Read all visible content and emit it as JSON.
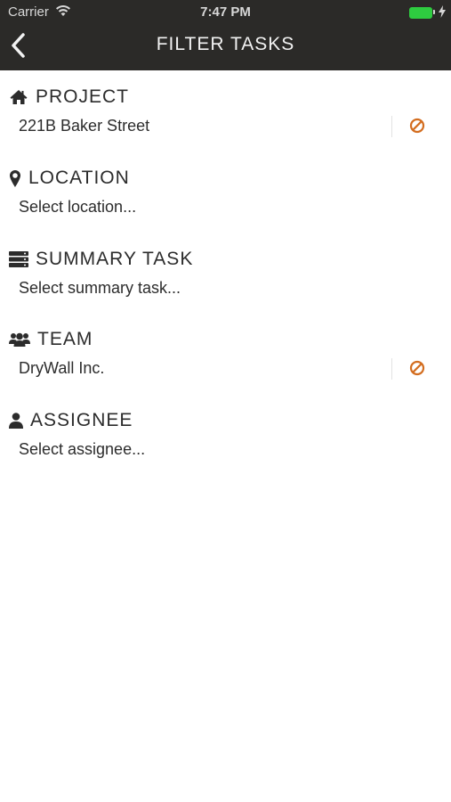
{
  "status_bar": {
    "carrier": "Carrier",
    "time": "7:47 PM"
  },
  "nav": {
    "title": "FILTER TASKS",
    "back_icon": "chevron-left-icon"
  },
  "colors": {
    "bar": "#2b2a28",
    "accent": "#d36d1f",
    "text": "#2c2c2c"
  },
  "sections": [
    {
      "title": "PROJECT",
      "icon": "home-icon",
      "value": "221B Baker Street"
    },
    {
      "title": "LOCATION",
      "icon": "map-marker-icon",
      "value": "Select location..."
    },
    {
      "title": "SUMMARY TASK",
      "icon": "server-icon",
      "value": "Select summary task..."
    },
    {
      "title": "TEAM",
      "icon": "users-icon",
      "value": "DryWall Inc."
    },
    {
      "title": "ASSIGNEE",
      "icon": "user-icon",
      "value": "Select assignee..."
    }
  ]
}
